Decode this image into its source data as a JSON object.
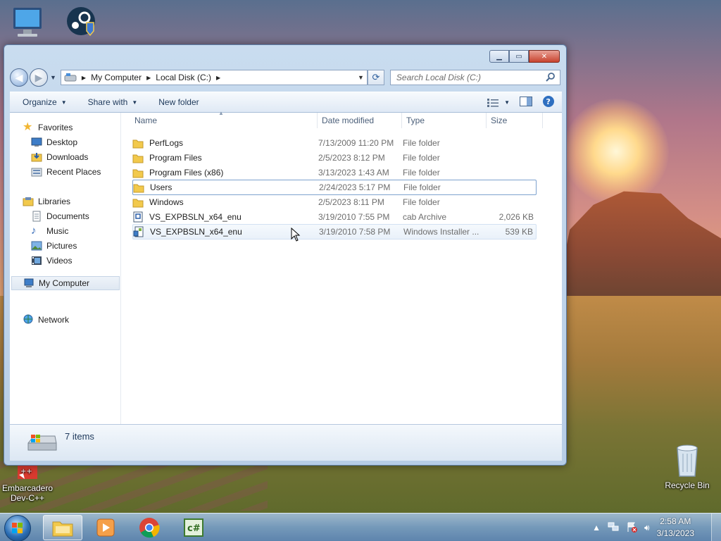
{
  "desktop": {
    "icons": [
      {
        "name": "my-computer-desktop",
        "label": ""
      },
      {
        "name": "steam",
        "label": ""
      },
      {
        "name": "embarcadero-devcpp",
        "label": "Embarcadero\nDev-C++"
      },
      {
        "name": "recycle-bin",
        "label": "Recycle Bin"
      }
    ]
  },
  "window": {
    "address": {
      "crumbs": [
        "My Computer",
        "Local Disk (C:)"
      ]
    },
    "search": {
      "placeholder": "Search Local Disk (C:)"
    },
    "toolbar": {
      "organize": "Organize",
      "share_with": "Share with",
      "new_folder": "New folder"
    },
    "nav": {
      "favorites": "Favorites",
      "desktop": "Desktop",
      "downloads": "Downloads",
      "recent_places": "Recent Places",
      "libraries": "Libraries",
      "documents": "Documents",
      "music": "Music",
      "pictures": "Pictures",
      "videos": "Videos",
      "my_computer": "My Computer",
      "network": "Network"
    },
    "columns": {
      "name": "Name",
      "date_modified": "Date modified",
      "type": "Type",
      "size": "Size"
    },
    "files": [
      {
        "name": "PerfLogs",
        "date": "7/13/2009 11:20 PM",
        "type": "File folder",
        "size": "",
        "icon": "folder-icon"
      },
      {
        "name": "Program Files",
        "date": "2/5/2023 8:12 PM",
        "type": "File folder",
        "size": "",
        "icon": "folder-icon"
      },
      {
        "name": "Program Files (x86)",
        "date": "3/13/2023 1:43 AM",
        "type": "File folder",
        "size": "",
        "icon": "folder-icon"
      },
      {
        "name": "Users",
        "date": "2/24/2023 5:17 PM",
        "type": "File folder",
        "size": "",
        "icon": "folder-icon"
      },
      {
        "name": "Windows",
        "date": "2/5/2023 8:11 PM",
        "type": "File folder",
        "size": "",
        "icon": "folder-icon"
      },
      {
        "name": "VS_EXPBSLN_x64_enu",
        "date": "3/19/2010 7:55 PM",
        "type": "cab Archive",
        "size": "2,026 KB",
        "icon": "cab-file-icon"
      },
      {
        "name": "VS_EXPBSLN_x64_enu",
        "date": "3/19/2010 7:58 PM",
        "type": "Windows Installer ...",
        "size": "539 KB",
        "icon": "installer-file-icon"
      }
    ],
    "status": {
      "item_count": "7 items"
    }
  },
  "taskbar": {
    "clock_time": "2:58 AM",
    "clock_date": "3/13/2023"
  },
  "colors": {
    "window_frame": "#b7cde6",
    "selection_border": "#7da2ce",
    "folder_yellow": "#f2c94c"
  }
}
